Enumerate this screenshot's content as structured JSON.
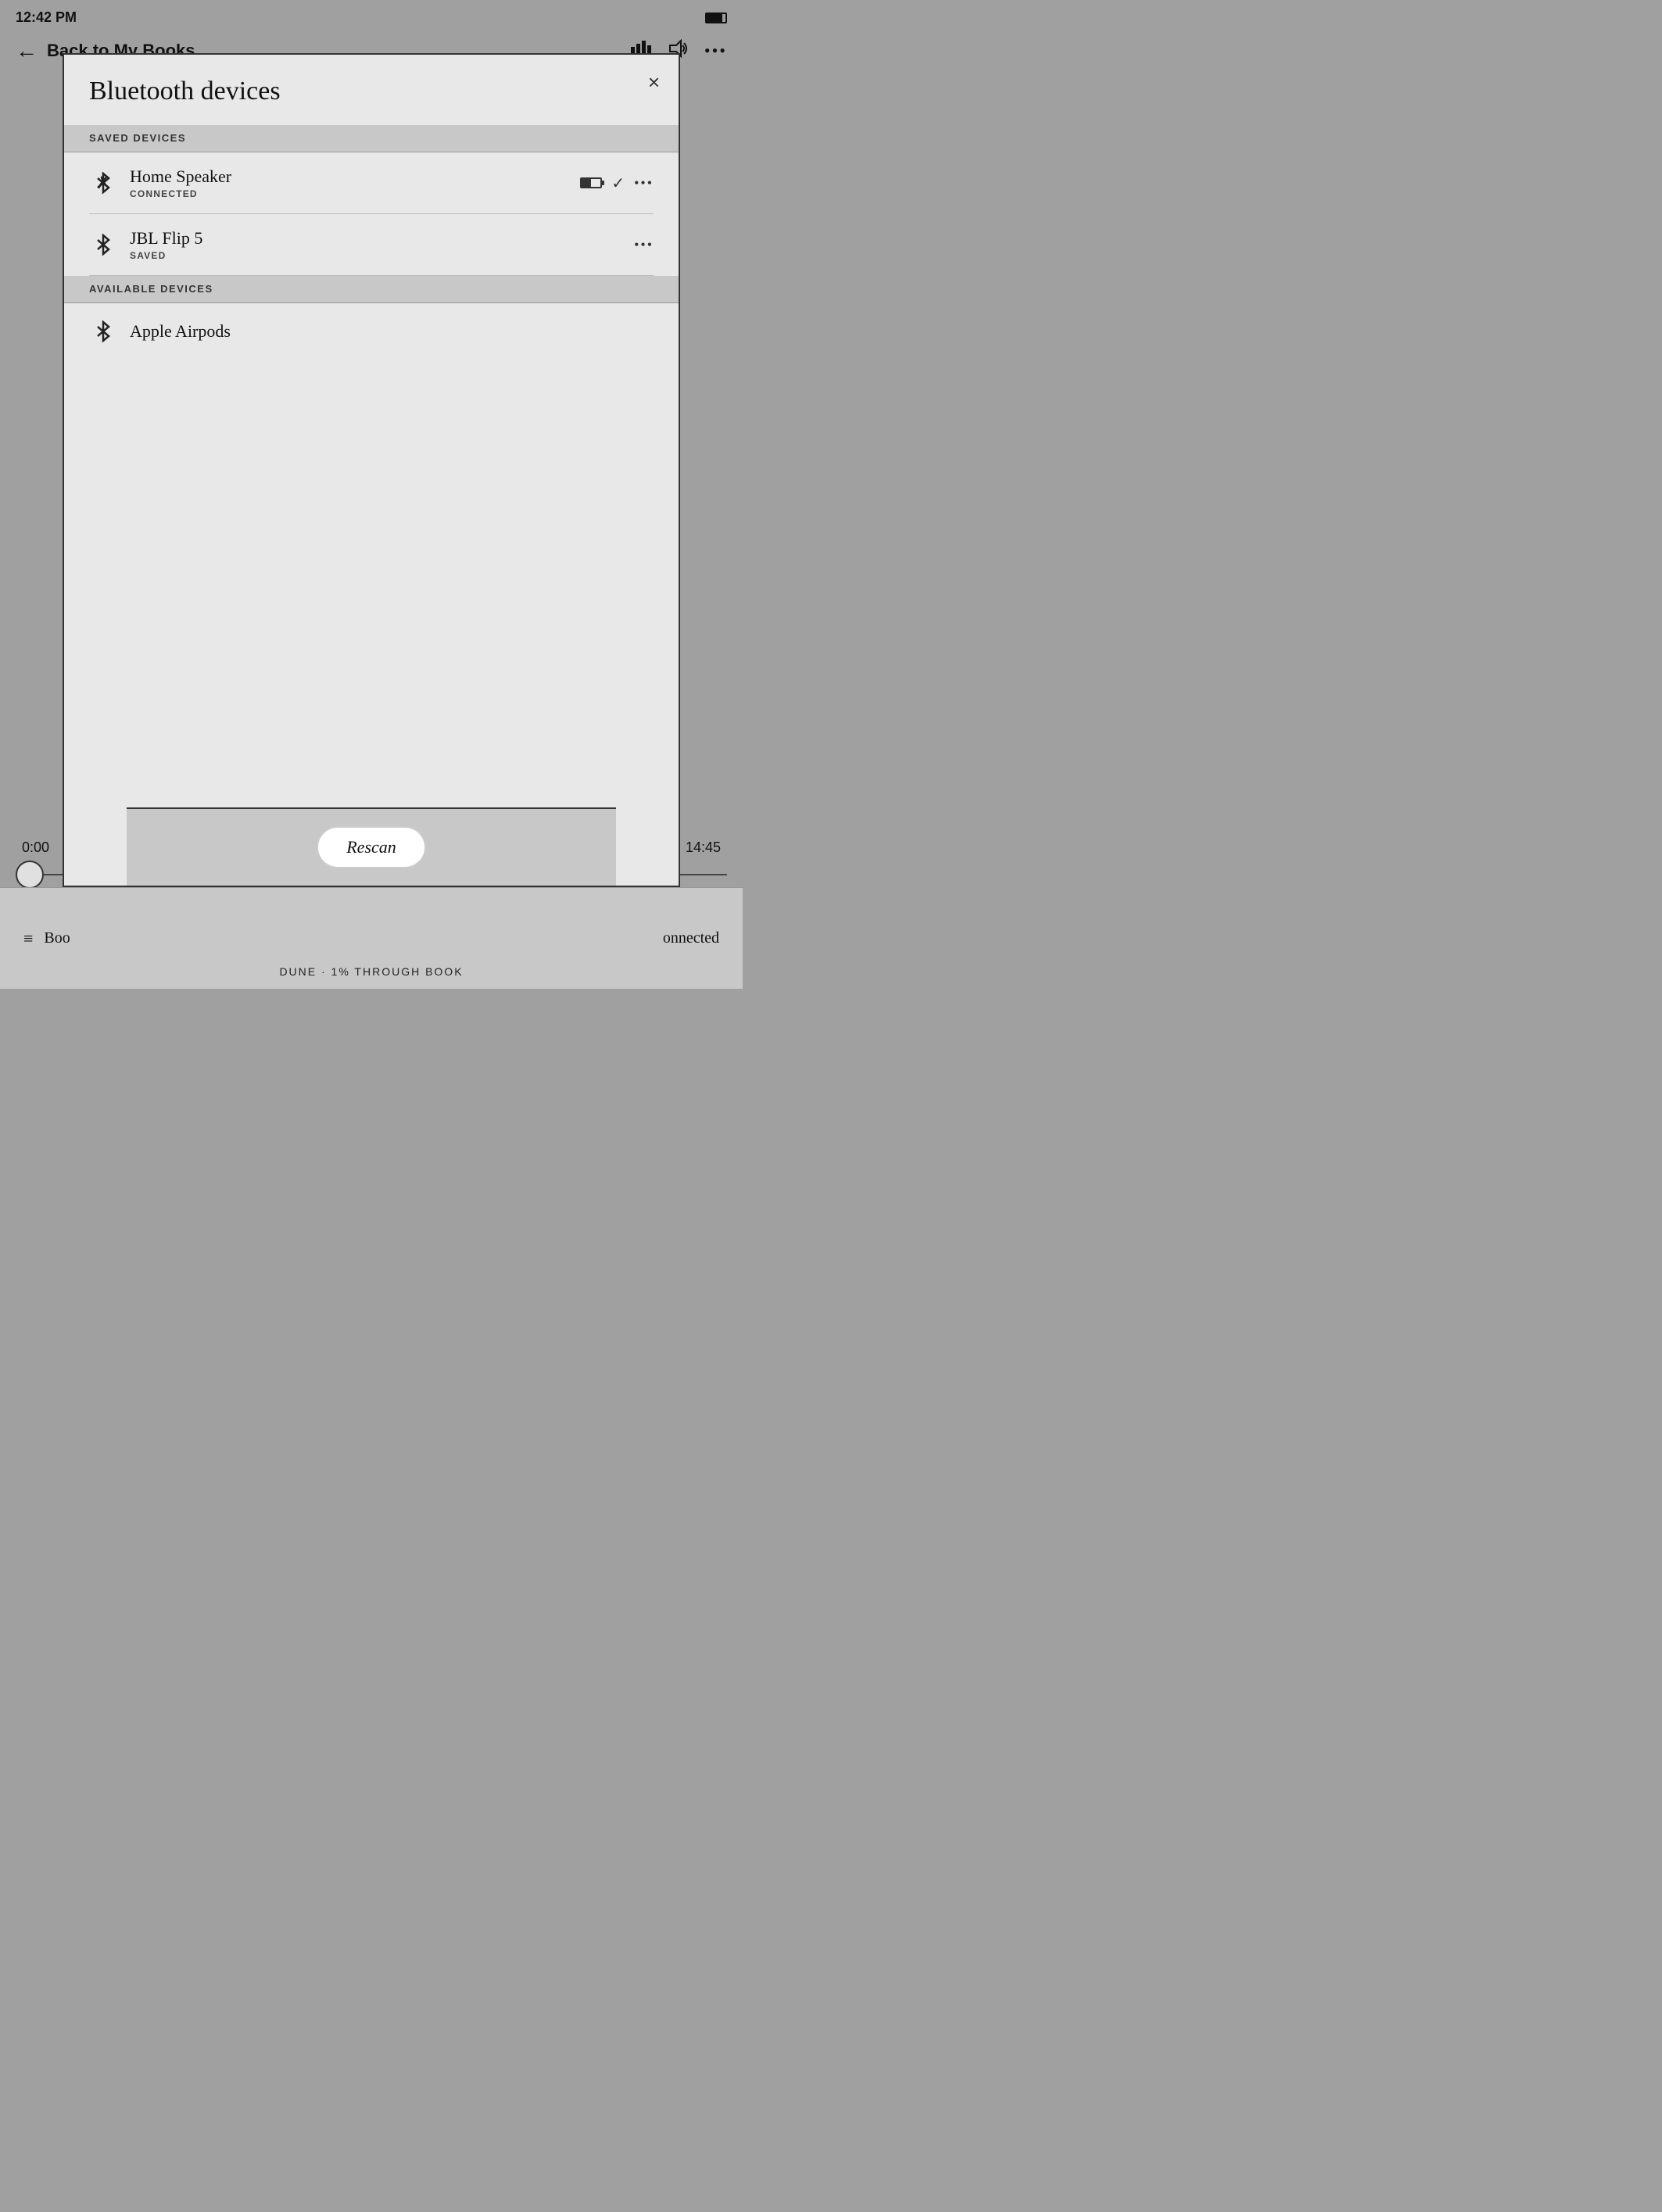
{
  "statusBar": {
    "time": "12:42 PM",
    "battery": "battery"
  },
  "navBar": {
    "backLabel": "← Back to My Books",
    "backArrow": "←",
    "title": "Back to My Books",
    "icons": {
      "bars": "bars-icon",
      "volume": "volume-icon",
      "more": "•••"
    }
  },
  "modal": {
    "title": "Bluetooth devices",
    "closeLabel": "×",
    "savedDevicesHeader": "SAVED DEVICES",
    "availableDevicesHeader": "AVAILABLE DEVICES",
    "savedDevices": [
      {
        "name": "Home Speaker",
        "status": "CONNECTED",
        "hasBattery": true,
        "hasCheck": true,
        "hasMenu": true
      },
      {
        "name": "JBL Flip 5",
        "status": "SAVED",
        "hasBattery": false,
        "hasCheck": false,
        "hasMenu": true
      }
    ],
    "availableDevices": [
      {
        "name": "Apple Airpods",
        "status": "",
        "hasMenu": false
      }
    ],
    "rescanButton": "Rescan"
  },
  "playback": {
    "startTime": "0:00",
    "endTime": "14:45"
  },
  "bottomBar": {
    "listIcon": "≡",
    "leftLabel": "Boo",
    "rightLabel": "onnected"
  },
  "footer": {
    "text": "DUNE · 1% THROUGH BOOK"
  }
}
